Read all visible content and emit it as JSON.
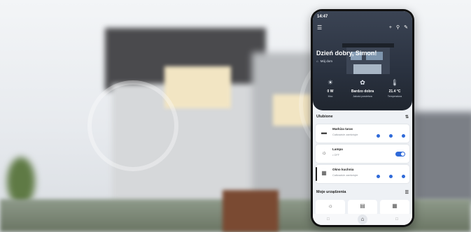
{
  "status": {
    "time": "14:47"
  },
  "header": {
    "greeting": "Dzień dobry, Simon!",
    "weather_text": "Mój dom"
  },
  "tiles": [
    {
      "icon": "sun-icon",
      "value": "0 W",
      "label": "Moc"
    },
    {
      "icon": "leaf-icon",
      "value": "Bardzo dobra",
      "label": "Jakość powietrza"
    },
    {
      "icon": "thermometer-icon",
      "value": "21.4 °C",
      "label": "Temperatura"
    }
  ],
  "favorites": {
    "title": "Ulubione",
    "items": [
      {
        "icon": "blind-icon",
        "name": "Markiza taras",
        "status": "Całkowicie zamknięte",
        "type": "shutter"
      },
      {
        "icon": "lamp-icon",
        "name": "Lampa",
        "status": "• OFF",
        "type": "toggle"
      },
      {
        "icon": "window-icon",
        "name": "Okno kuchnia",
        "status": "Całkowicie zamknięte",
        "type": "shutter"
      }
    ]
  },
  "devices": {
    "title": "Moje urządzenia"
  },
  "colors": {
    "accent": "#2f6ad9",
    "hero": "#2a3240"
  }
}
